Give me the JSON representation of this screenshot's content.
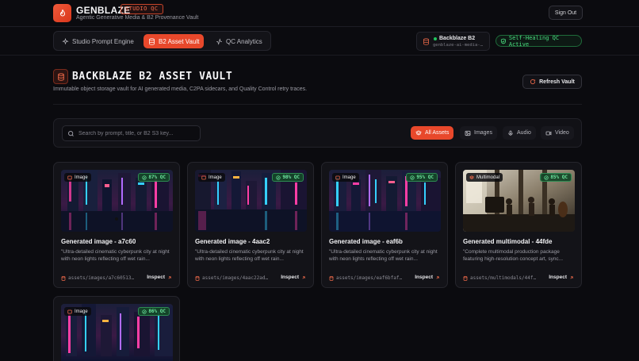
{
  "app": {
    "name": "GENBLAZE",
    "badge": "STUDIO QC",
    "tagline": "Agentic Generative Media & B2 Provenance Vault",
    "sign_out": "Sign Out"
  },
  "nav": {
    "tabs": [
      {
        "label": "Studio Prompt Engine",
        "active": false,
        "icon": "sparkles-icon"
      },
      {
        "label": "B2 Asset Vault",
        "active": true,
        "icon": "database-icon"
      },
      {
        "label": "QC Analytics",
        "active": false,
        "icon": "activity-icon"
      }
    ]
  },
  "storage": {
    "title": "Backblaze B2",
    "bucket": "genblaze-ai-media-…",
    "status": "Self-Healing QC Active"
  },
  "page": {
    "title": "BACKBLAZE B2 ASSET VAULT",
    "subtitle": "Immutable object storage vault for AI generated media, C2PA sidecars, and Quality Control retry traces.",
    "refresh_label": "Refresh Vault"
  },
  "filters": {
    "search_placeholder": "Search by prompt, title, or B2 S3 key...",
    "options": [
      {
        "label": "All Assets",
        "active": true,
        "icon": "layers-icon"
      },
      {
        "label": "Images",
        "active": false,
        "icon": "image-icon"
      },
      {
        "label": "Audio",
        "active": false,
        "icon": "mic-icon"
      },
      {
        "label": "Video",
        "active": false,
        "icon": "video-icon"
      }
    ]
  },
  "assets": [
    {
      "type": "Image",
      "qc": "87% QC",
      "title": "Generated image - a7c60",
      "desc": "\"Ultra-detailed cinematic cyberpunk city at night with neon lights reflecting off wet rain...",
      "path": "assets/images/a7c60513…",
      "inspect": "Inspect",
      "scene": "city"
    },
    {
      "type": "Image",
      "qc": "98% QC",
      "title": "Generated image - 4aac2",
      "desc": "\"Ultra-detailed cinematic cyberpunk city at night with neon lights reflecting off wet rain...",
      "path": "assets/images/4aac22ad…",
      "inspect": "Inspect",
      "scene": "city"
    },
    {
      "type": "Image",
      "qc": "95% QC",
      "title": "Generated image - eaf6b",
      "desc": "\"Ultra-detailed cinematic cyberpunk city at night with neon lights reflecting off wet rain...",
      "path": "assets/images/eaf6bfaf…",
      "inspect": "Inspect",
      "scene": "city"
    },
    {
      "type": "Multimodal",
      "qc": "85% QC",
      "title": "Generated multimodal - 44fde",
      "desc": "\"Complete multimodal production package featuring high-resolution concept art, sync...",
      "path": "assets/multimodals/44f…",
      "inspect": "Inspect",
      "scene": "interior"
    },
    {
      "type": "Image",
      "qc": "86% QC",
      "title": "",
      "desc": "",
      "path": "",
      "inspect": "",
      "scene": "city"
    }
  ]
}
